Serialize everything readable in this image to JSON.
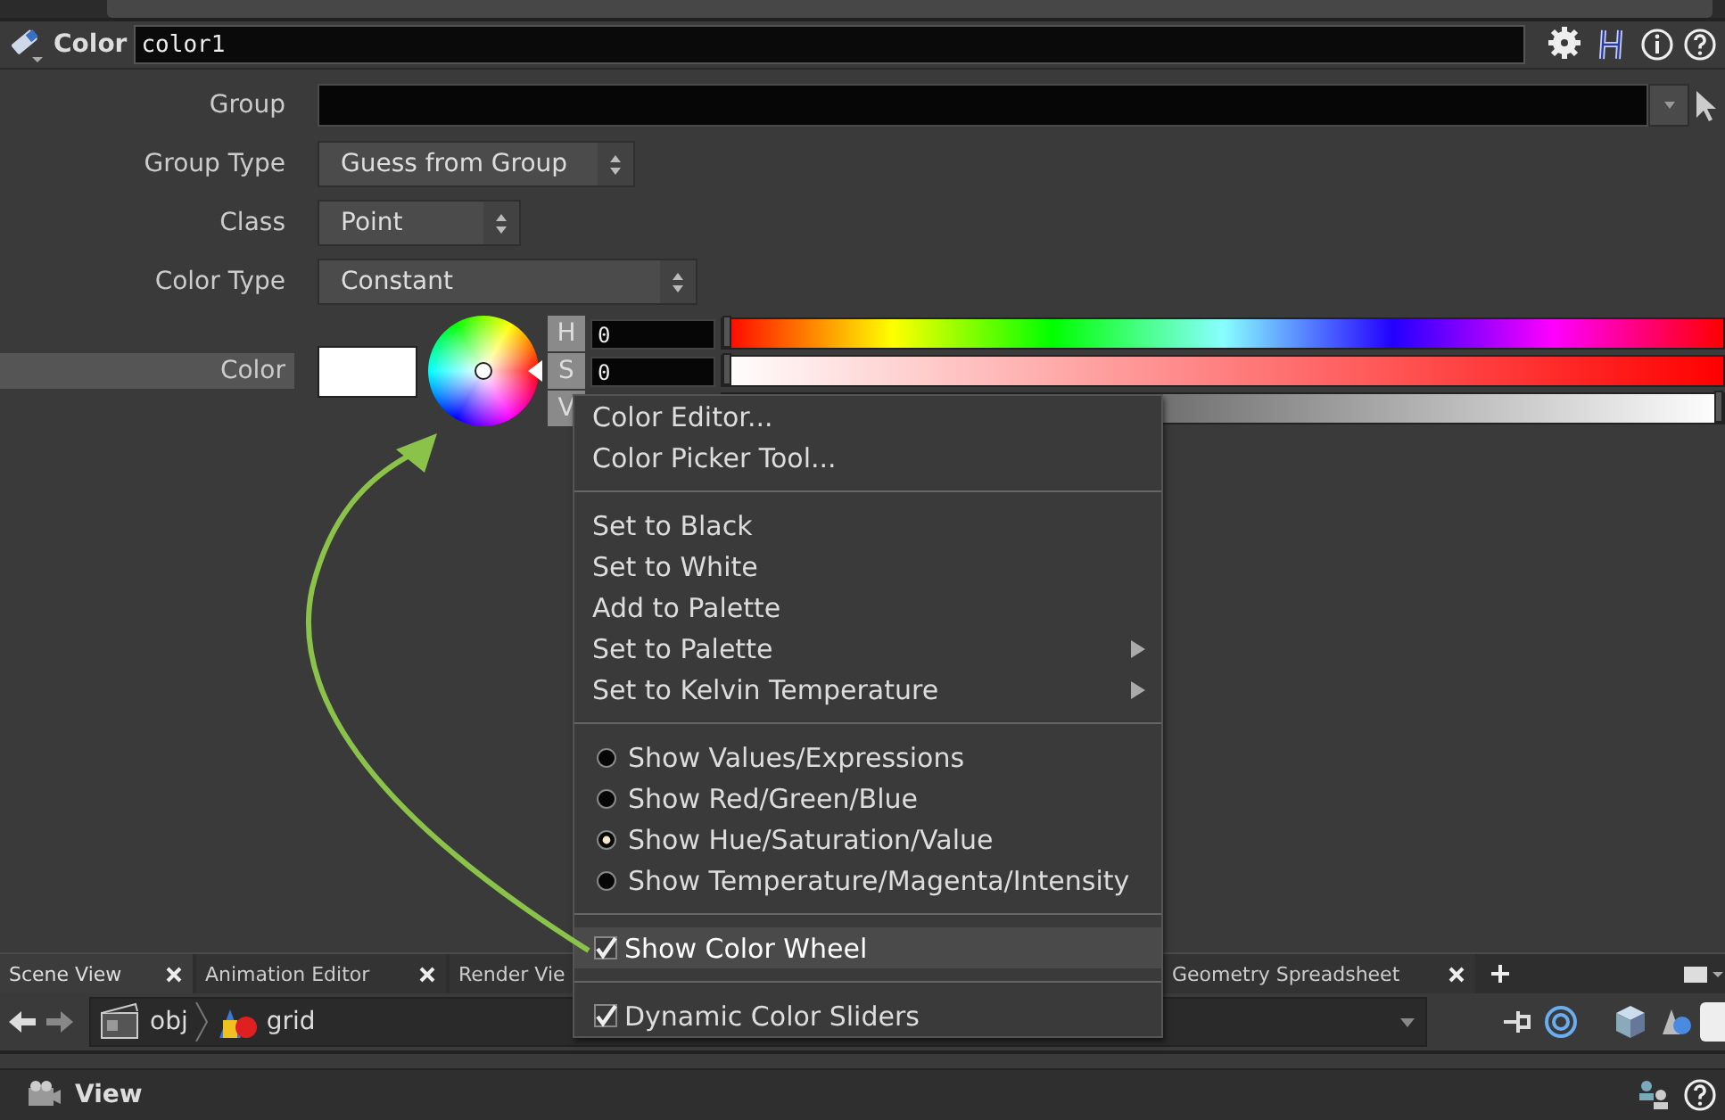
{
  "node": {
    "type_label": "Color",
    "name": "color1"
  },
  "parameters": [
    {
      "label": "Group",
      "kind": "field"
    },
    {
      "label": "Group Type",
      "kind": "menu",
      "value": "Guess from Group"
    },
    {
      "label": "Class",
      "kind": "menu",
      "value": "Point"
    },
    {
      "label": "Color Type",
      "kind": "menu",
      "value": "Constant"
    }
  ],
  "color_param": {
    "label": "Color",
    "channels": [
      {
        "label": "H",
        "value": "0",
        "level": 0,
        "kind": "hue"
      },
      {
        "label": "S",
        "value": "0",
        "level": 0,
        "kind": "saturation"
      },
      {
        "label": "V",
        "level": 1,
        "kind": "value"
      }
    ]
  },
  "context_menu": {
    "sections": [
      [
        {
          "label": "Color Editor...",
          "kind": "action"
        },
        {
          "label": "Color Picker Tool...",
          "kind": "action"
        }
      ],
      [
        {
          "label": "Set to Black",
          "kind": "action"
        },
        {
          "label": "Set to White",
          "kind": "action"
        },
        {
          "label": "Add to Palette",
          "kind": "action"
        },
        {
          "label": "Set to Palette",
          "kind": "submenu"
        },
        {
          "label": "Set to Kelvin Temperature",
          "kind": "submenu"
        }
      ],
      [
        {
          "label": "Show Values/Expressions",
          "kind": "radio",
          "selected": false
        },
        {
          "label": "Show Red/Green/Blue",
          "kind": "radio",
          "selected": false
        },
        {
          "label": "Show Hue/Saturation/Value",
          "kind": "radio",
          "selected": true
        },
        {
          "label": "Show Temperature/Magenta/Intensity",
          "kind": "radio",
          "selected": false
        }
      ],
      [
        {
          "label": "Show Color Wheel",
          "kind": "check",
          "checked": true,
          "highlighted": true
        }
      ],
      [
        {
          "label": "Dynamic Color Sliders",
          "kind": "check",
          "checked": true,
          "highlighted": false
        }
      ]
    ]
  },
  "pane_tabs": [
    {
      "label": "Scene View",
      "selected": true
    },
    {
      "label": "Animation Editor",
      "selected": false
    },
    {
      "label": "Render Vie",
      "selected": false
    },
    {
      "label": "Geometry Spreadsheet",
      "selected": false
    }
  ],
  "path": [
    "obj",
    "grid"
  ],
  "view_pane": {
    "title": "View"
  }
}
